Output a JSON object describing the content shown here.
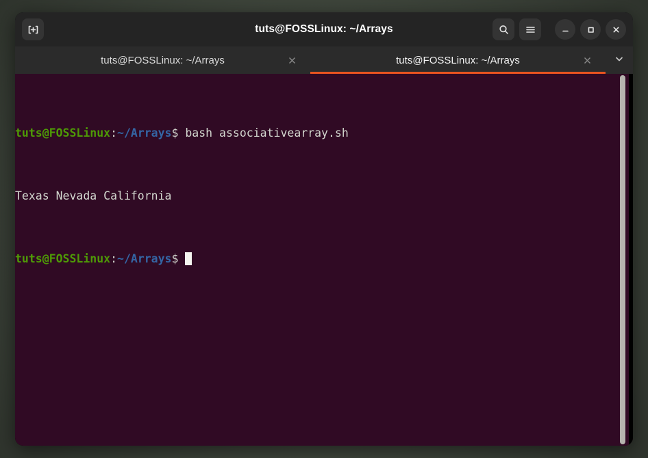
{
  "window": {
    "title": "tuts@FOSSLinux: ~/Arrays",
    "accent_color": "#e95420",
    "titlebar_bg": "#242424",
    "tabbar_bg": "#2b2b2b",
    "terminal_bg": "#300a24"
  },
  "titlebar": {
    "new_tab_icon": "new-tab-icon",
    "search_icon": "search-icon",
    "menu_icon": "hamburger-menu-icon",
    "minimize_icon": "minimize-icon",
    "maximize_icon": "maximize-icon",
    "close_icon": "close-icon"
  },
  "tabs": [
    {
      "label": "tuts@FOSSLinux: ~/Arrays",
      "active": false,
      "close_icon": "close-icon"
    },
    {
      "label": "tuts@FOSSLinux: ~/Arrays",
      "active": true,
      "close_icon": "close-icon"
    }
  ],
  "tab_list_icon": "chevron-down-icon",
  "terminal": {
    "prompt": {
      "user_host": "tuts@FOSSLinux",
      "colon": ":",
      "path": "~/Arrays",
      "symbol": "$ "
    },
    "lines": [
      {
        "type": "prompt",
        "command": "bash associativearray.sh"
      },
      {
        "type": "output",
        "text": "Texas Nevada California"
      },
      {
        "type": "prompt",
        "command": ""
      }
    ],
    "colors": {
      "user_host": "#4e9a06",
      "path": "#3465a4",
      "text": "#d3d7cf",
      "cursor": "#f5f5f0"
    }
  },
  "scrollbar": {
    "name": "vertical-scrollbar"
  }
}
